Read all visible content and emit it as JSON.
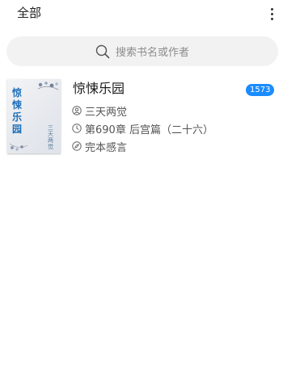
{
  "header": {
    "title": "全部",
    "more_icon": "more-vertical-icon"
  },
  "search": {
    "placeholder": "搜索书名或作者",
    "icon": "search-icon"
  },
  "books": [
    {
      "title": "惊悚乐园",
      "cover_title": "惊悚乐园",
      "cover_author": "三天两觉",
      "author": "三天两觉",
      "latest_chapter": "第690章 后宫篇（二十六）",
      "status": "完本感言",
      "unread_count": "1573",
      "badge_color": "#1a8cff",
      "author_icon": "user-icon",
      "latest_icon": "clock-icon",
      "status_icon": "compass-icon"
    }
  ]
}
